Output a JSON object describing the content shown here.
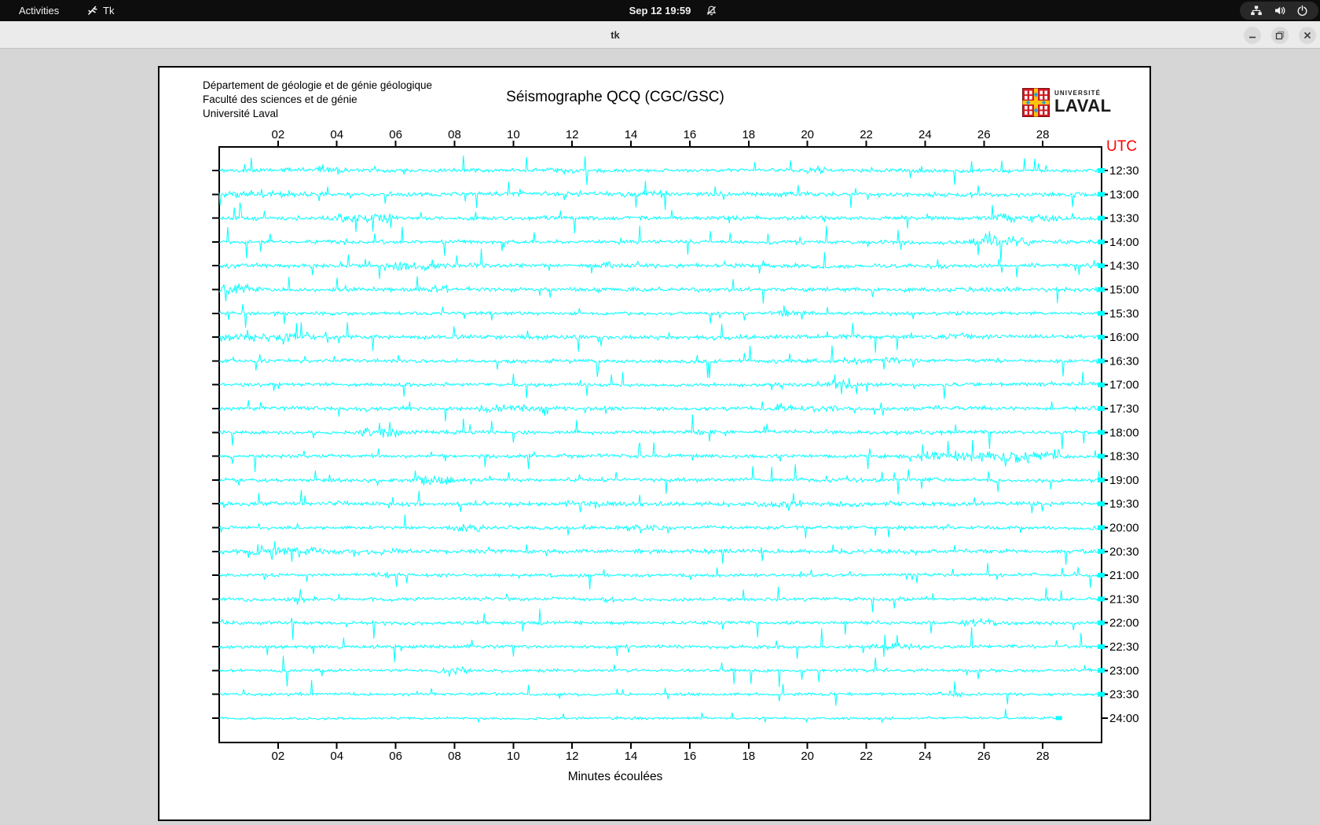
{
  "top_bar": {
    "activities": "Activities",
    "app_name": "Tk",
    "clock": "Sep 12 19:59",
    "status_icons": [
      "notifications-off-icon",
      "network-icon",
      "volume-icon",
      "power-icon"
    ]
  },
  "window": {
    "title": "tk",
    "controls": [
      "minimize",
      "maximize",
      "close"
    ]
  },
  "page_content": {
    "institution_lines": [
      "Département de géologie et de génie géologique",
      "Faculté des sciences et de génie",
      "Université Laval"
    ],
    "title": "Séismographe QCQ (CGC/GSC)",
    "logo_university": "UNIVERSITÉ",
    "logo_name": "LAVAL",
    "utc_label": "UTC",
    "x_axis_title": "Minutes écoulées"
  },
  "colors": {
    "desktop_bar_bg": "#0d0d0d",
    "titlebar_bg": "#ebebeb",
    "window_bg": "#d6d6d6",
    "page_bg": "#ffffff",
    "trace": "#00ffff",
    "axis": "#000000",
    "utc_red": "#ff0000",
    "logo_red": "#d01a21",
    "logo_gold": "#ffc20e",
    "logo_blue": "#2aa3dc"
  },
  "chart_data": {
    "type": "line",
    "title": "Séismographe QCQ (CGC/GSC)",
    "xlabel": "Minutes écoulées",
    "right_axis_label": "UTC",
    "x_range_minutes": [
      0,
      30
    ],
    "x_tick_minutes": [
      2,
      4,
      6,
      8,
      10,
      12,
      14,
      16,
      18,
      20,
      22,
      24,
      26,
      28
    ],
    "x_ticks": [
      "02",
      "04",
      "06",
      "08",
      "10",
      "12",
      "14",
      "16",
      "18",
      "20",
      "22",
      "24",
      "26",
      "28"
    ],
    "trace_color": "#00ffff",
    "axis_color": "#000000",
    "row_spacing_minutes": 30,
    "rows": [
      {
        "label": "12:30",
        "end_minute": 30,
        "seed": 11,
        "amp": 2.2,
        "spike_amp": 14,
        "spike_rate": 1.0,
        "bursts": [
          [
            3.4,
            4.1,
            2.0
          ],
          [
            11.2,
            12.0,
            1.7
          ],
          [
            20,
            20.6,
            1.8
          ]
        ]
      },
      {
        "label": "13:00",
        "end_minute": 30,
        "seed": 23,
        "amp": 2.6,
        "spike_amp": 13,
        "spike_rate": 1.2,
        "bursts": [
          [
            0.4,
            2.3,
            2.1
          ],
          [
            14,
            15,
            1.6
          ]
        ]
      },
      {
        "label": "13:30",
        "end_minute": 30,
        "seed": 37,
        "amp": 2.4,
        "spike_amp": 14,
        "spike_rate": 1.1,
        "bursts": [
          [
            4.2,
            5.8,
            3.0
          ],
          [
            26.6,
            28.4,
            2.3
          ]
        ]
      },
      {
        "label": "14:00",
        "end_minute": 30,
        "seed": 41,
        "amp": 2.3,
        "spike_amp": 16,
        "spike_rate": 1.2,
        "bursts": [
          [
            3.9,
            4.4,
            1.8
          ],
          [
            25.6,
            27.4,
            2.6
          ]
        ]
      },
      {
        "label": "14:30",
        "end_minute": 30,
        "seed": 53,
        "amp": 2.5,
        "spike_amp": 15,
        "spike_rate": 1.1,
        "bursts": [
          [
            6,
            8,
            2.1
          ],
          [
            12.5,
            13.2,
            1.7
          ]
        ]
      },
      {
        "label": "15:00",
        "end_minute": 30,
        "seed": 67,
        "amp": 2.6,
        "spike_amp": 14,
        "spike_rate": 1.0,
        "bursts": [
          [
            0,
            1.2,
            2.8
          ],
          [
            7,
            7.7,
            1.9
          ]
        ]
      },
      {
        "label": "15:30",
        "end_minute": 30,
        "seed": 79,
        "amp": 2.1,
        "spike_amp": 13,
        "spike_rate": 0.9,
        "bursts": [
          [
            19,
            20,
            1.7
          ]
        ]
      },
      {
        "label": "16:00",
        "end_minute": 30,
        "seed": 97,
        "amp": 2.6,
        "spike_amp": 14,
        "spike_rate": 1.0,
        "bursts": [
          [
            0,
            3,
            2.2
          ],
          [
            24.4,
            25.4,
            1.9
          ]
        ]
      },
      {
        "label": "16:30",
        "end_minute": 30,
        "seed": 113,
        "amp": 2.2,
        "spike_amp": 15,
        "spike_rate": 1.0,
        "bursts": [
          [
            21,
            23,
            1.8
          ]
        ]
      },
      {
        "label": "17:00",
        "end_minute": 30,
        "seed": 131,
        "amp": 2.2,
        "spike_amp": 15,
        "spike_rate": 1.1,
        "bursts": [
          [
            20.4,
            21.6,
            2.2
          ]
        ]
      },
      {
        "label": "17:30",
        "end_minute": 30,
        "seed": 149,
        "amp": 2.4,
        "spike_amp": 14,
        "spike_rate": 1.0,
        "bursts": [
          [
            9,
            11,
            1.7
          ],
          [
            19,
            21,
            1.9
          ]
        ]
      },
      {
        "label": "18:00",
        "end_minute": 30,
        "seed": 163,
        "amp": 2.3,
        "spike_amp": 16,
        "spike_rate": 1.0,
        "bursts": [
          [
            5,
            6,
            2.5
          ],
          [
            16.4,
            17,
            1.7
          ]
        ]
      },
      {
        "label": "18:30",
        "end_minute": 30,
        "seed": 181,
        "amp": 2.3,
        "spike_amp": 14,
        "spike_rate": 1.0,
        "bursts": [
          [
            24,
            28.5,
            2.8
          ]
        ]
      },
      {
        "label": "19:00",
        "end_minute": 30,
        "seed": 199,
        "amp": 2.3,
        "spike_amp": 14,
        "spike_rate": 1.0,
        "bursts": [
          [
            6.8,
            7.8,
            2.7
          ]
        ]
      },
      {
        "label": "19:30",
        "end_minute": 30,
        "seed": 211,
        "amp": 2.6,
        "spike_amp": 13,
        "spike_rate": 1.2,
        "bursts": [
          [
            12,
            14,
            1.7
          ],
          [
            18.4,
            19.6,
            1.9
          ]
        ]
      },
      {
        "label": "20:00",
        "end_minute": 30,
        "seed": 229,
        "amp": 2.2,
        "spike_amp": 13,
        "spike_rate": 0.9,
        "bursts": [
          [
            8,
            8.8,
            1.9
          ],
          [
            14,
            14.8,
            1.9
          ]
        ]
      },
      {
        "label": "20:30",
        "end_minute": 30,
        "seed": 241,
        "amp": 2.6,
        "spike_amp": 12,
        "spike_rate": 0.9,
        "bursts": [
          [
            0,
            6,
            1.6
          ]
        ]
      },
      {
        "label": "21:00",
        "end_minute": 30,
        "seed": 257,
        "amp": 1.9,
        "spike_amp": 12,
        "spike_rate": 0.8,
        "bursts": [
          [
            5.4,
            6.2,
            1.7
          ]
        ]
      },
      {
        "label": "21:30",
        "end_minute": 30,
        "seed": 271,
        "amp": 2.1,
        "spike_amp": 13,
        "spike_rate": 0.9,
        "bursts": [
          [
            2.4,
            3.2,
            1.8
          ],
          [
            13,
            13.7,
            1.9
          ]
        ]
      },
      {
        "label": "22:00",
        "end_minute": 30,
        "seed": 283,
        "amp": 2.1,
        "spike_amp": 15,
        "spike_rate": 0.9,
        "bursts": [
          [
            25.4,
            26.2,
            2.3
          ]
        ]
      },
      {
        "label": "22:30",
        "end_minute": 30,
        "seed": 307,
        "amp": 2.0,
        "spike_amp": 18,
        "spike_rate": 0.9,
        "bursts": [
          [
            22.4,
            23.6,
            2.4
          ]
        ]
      },
      {
        "label": "23:00",
        "end_minute": 30,
        "seed": 317,
        "amp": 1.9,
        "spike_amp": 16,
        "spike_rate": 0.8,
        "bursts": [
          [
            7.7,
            8.4,
            2.3
          ]
        ]
      },
      {
        "label": "23:30",
        "end_minute": 30,
        "seed": 337,
        "amp": 1.7,
        "spike_amp": 12,
        "spike_rate": 0.7,
        "bursts": [
          [
            24.7,
            25.4,
            2.1
          ]
        ]
      },
      {
        "label": "24:00",
        "end_minute": 28.6,
        "seed": 353,
        "amp": 1.5,
        "spike_amp": 9,
        "spike_rate": 0.5,
        "bursts": [
          [
            12,
            16,
            1.3
          ]
        ]
      }
    ]
  }
}
